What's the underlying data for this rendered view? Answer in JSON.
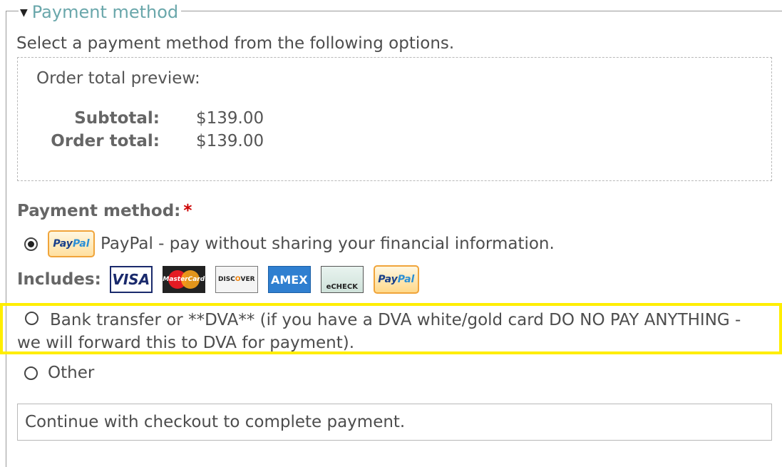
{
  "fieldset": {
    "legend": "Payment method"
  },
  "intro": "Select a payment method from the following options.",
  "preview": {
    "title": "Order total preview:",
    "rows": [
      {
        "label": "Subtotal:",
        "value": "$139.00"
      },
      {
        "label": "Order total:",
        "value": "$139.00"
      }
    ]
  },
  "payment_method": {
    "label": "Payment method:",
    "required_marker": "*",
    "options": [
      {
        "label": "PayPal - pay without sharing your financial information.",
        "selected": true
      },
      {
        "label": "Bank transfer or **DVA** (if you have a DVA white/gold card DO NO PAY ANYTHING - we will forward this to DVA for payment).",
        "selected": false
      },
      {
        "label": "Other",
        "selected": false
      }
    ],
    "includes_label": "Includes:",
    "logos": {
      "paypal_pay": "Pay",
      "paypal_pal": "Pal",
      "visa": "VISA",
      "mastercard": "MasterCard",
      "discover_a": "DISC",
      "discover_o": "O",
      "discover_b": "VER",
      "amex": "AMEX",
      "echeck": "eCHECK"
    }
  },
  "note": "Continue with checkout to complete payment.",
  "colors": {
    "legend": "#6aa7ab",
    "required": "#cc0000",
    "highlight": "#ffee00"
  }
}
